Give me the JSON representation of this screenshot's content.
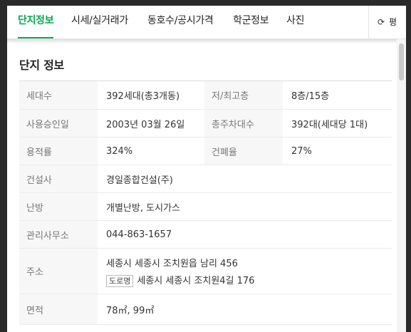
{
  "tabs": [
    {
      "label": "단지정보",
      "active": true
    },
    {
      "label": "시세/실거래가",
      "active": false
    },
    {
      "label": "동호수/공시가격",
      "active": false
    },
    {
      "label": "학군정보",
      "active": false
    },
    {
      "label": "사진",
      "active": false
    }
  ],
  "refresh": {
    "icon": "refresh-icon",
    "label": "평"
  },
  "section_title": "단지 정보",
  "rows": {
    "households": {
      "label": "세대수",
      "value": "392세대(총3개동)"
    },
    "floors": {
      "label": "저/최고층",
      "value": "8층/15층"
    },
    "approval": {
      "label": "사용승인일",
      "value": "2003년 03월 26일"
    },
    "parking": {
      "label": "총주차대수",
      "value": "392대(세대당 1대)"
    },
    "far": {
      "label": "용적률",
      "value": "324%"
    },
    "bcr": {
      "label": "건폐율",
      "value": "27%"
    },
    "builder": {
      "label": "건설사",
      "value": "경일종합건설(주)"
    },
    "heating": {
      "label": "난방",
      "value": "개별난방, 도시가스"
    },
    "office": {
      "label": "관리사무소",
      "value": "044-863-1657"
    },
    "address": {
      "label": "주소",
      "jibun": "세종시 세종시 조치원읍 남리 456",
      "road_badge": "도로명",
      "road": "세종시 세종시 조치원4길 176"
    },
    "area": {
      "label": "면적",
      "value": "78㎡, 99㎡"
    }
  },
  "colors": {
    "accent": "#03a94f",
    "label_bg": "#f7f7f7"
  }
}
